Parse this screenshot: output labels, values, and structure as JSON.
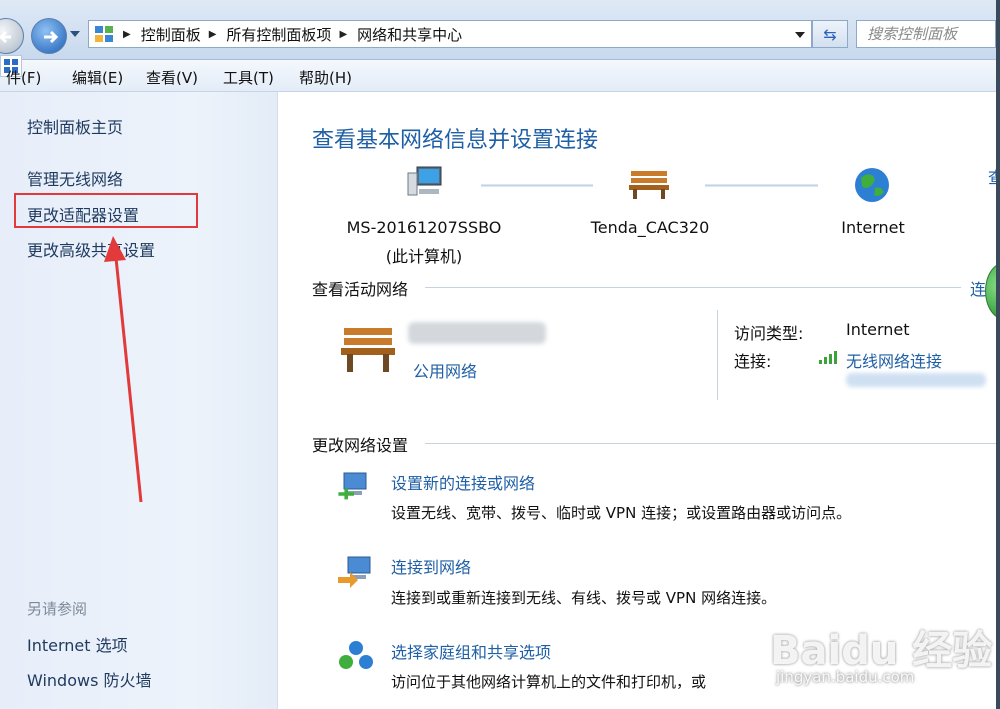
{
  "address_bar": {
    "breadcrumbs": [
      "控制面板",
      "所有控制面板项",
      "网络和共享中心"
    ],
    "search_placeholder": "搜索控制面板"
  },
  "menu": {
    "items": [
      "文件(F)",
      "编辑(E)",
      "查看(V)",
      "工具(T)",
      "帮助(H)"
    ],
    "first_visible": "件(F)"
  },
  "sidebar": {
    "home": "控制面板主页",
    "links": [
      "管理无线网络",
      "更改适配器设置",
      "更改高级共享设置"
    ],
    "see_also_heading": "另请参阅",
    "see_also": [
      "Internet 选项",
      "Windows 防火墙"
    ]
  },
  "main": {
    "title": "查看基本网络信息并设置连接",
    "right_cut_link": "查",
    "map": {
      "computer_name": "MS-20161207SSBO",
      "computer_sub": "(此计算机)",
      "network_name": "Tenda_CAC320",
      "internet": "Internet"
    },
    "active": {
      "heading": "查看活动网络",
      "right_cut_link": "连",
      "network_type": "公用网络",
      "access_type_label": "访问类型:",
      "access_type_value": "Internet",
      "connection_label": "连接:",
      "connection_value": "无线网络连接"
    },
    "change_heading": "更改网络设置",
    "tasks": [
      {
        "title": "设置新的连接或网络",
        "desc": "设置无线、宽带、拨号、临时或 VPN 连接；或设置路由器或访问点。"
      },
      {
        "title": "连接到网络",
        "desc": "连接到或重新连接到无线、有线、拨号或 VPN 网络连接。"
      },
      {
        "title": "选择家庭组和共享选项",
        "desc": "访问位于其他网络计算机上的文件和打印机，或"
      }
    ]
  },
  "watermark": {
    "logo": "Baidu 经验",
    "url": "jingyan.baidu.com"
  },
  "colors": {
    "link": "#1f5fa6",
    "highlight": "#e23a3a"
  }
}
